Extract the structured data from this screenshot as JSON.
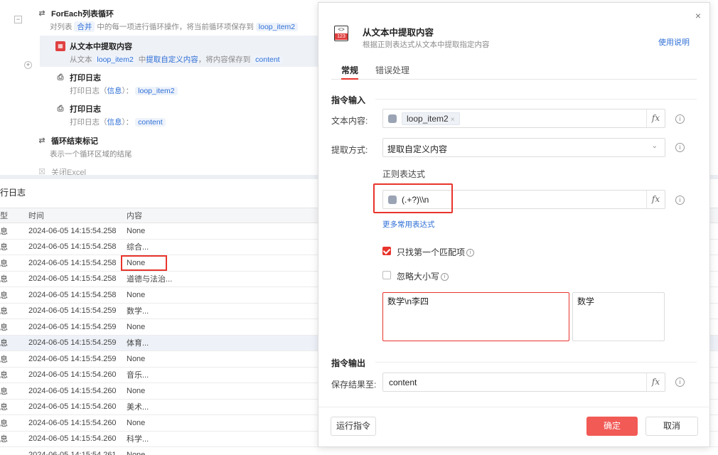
{
  "flow": {
    "items": [
      {
        "title": "ForEach列表循环",
        "desc_pre": "对列表 ",
        "desc_pill": "合并",
        "desc_mid": " 中的每一项进行循环操作，将当前循环项保存到 ",
        "desc_pill2": "loop_item2",
        "icon": "loop-icon"
      },
      {
        "title": "从文本中提取内容",
        "desc_pre": "从文本 ",
        "desc_pill": "loop_item2",
        "desc_mid": " 中",
        "desc_link": "提取自定义内容",
        "desc_post": "，将内容保存到 ",
        "desc_pill2": "content",
        "icon": "extract-text-icon"
      },
      {
        "title": "打印日志",
        "desc_pre": "打印日志（",
        "desc_pill": "信息",
        "desc_mid": "）： ",
        "desc_pill2": "loop_item2",
        "icon": "print-icon"
      },
      {
        "title": "打印日志",
        "desc_pre": "打印日志（",
        "desc_pill": "信息",
        "desc_mid": "）： ",
        "desc_pill2": "content",
        "icon": "print-icon"
      },
      {
        "title": "循环结束标记",
        "desc_pre": "表示一个循环区域的结尾",
        "icon": "loop-end-icon"
      },
      {
        "title": "关闭Excel",
        "icon": "excel-icon"
      }
    ],
    "collapse_symbol": "−",
    "add_symbol": "+"
  },
  "log": {
    "title": "行日志",
    "headers": {
      "type": "型",
      "time": "时间",
      "content": "内容"
    },
    "rows": [
      {
        "type": "息",
        "time": "2024-06-05 14:15:54.258",
        "content": "None"
      },
      {
        "type": "息",
        "time": "2024-06-05 14:15:54.258",
        "content": "综合..."
      },
      {
        "type": "息",
        "time": "2024-06-05 14:15:54.258",
        "content": "None"
      },
      {
        "type": "息",
        "time": "2024-06-05 14:15:54.258",
        "content": "道德与法治..."
      },
      {
        "type": "息",
        "time": "2024-06-05 14:15:54.258",
        "content": "None"
      },
      {
        "type": "息",
        "time": "2024-06-05 14:15:54.259",
        "content": "数学..."
      },
      {
        "type": "息",
        "time": "2024-06-05 14:15:54.259",
        "content": "None"
      },
      {
        "type": "息",
        "time": "2024-06-05 14:15:54.259",
        "content": "体育..."
      },
      {
        "type": "息",
        "time": "2024-06-05 14:15:54.259",
        "content": "None"
      },
      {
        "type": "息",
        "time": "2024-06-05 14:15:54.260",
        "content": "音乐..."
      },
      {
        "type": "息",
        "time": "2024-06-05 14:15:54.260",
        "content": "None"
      },
      {
        "type": "息",
        "time": "2024-06-05 14:15:54.260",
        "content": "美术..."
      },
      {
        "type": "息",
        "time": "2024-06-05 14:15:54.260",
        "content": "None"
      },
      {
        "type": "息",
        "time": "2024-06-05 14:15:54.260",
        "content": "科学..."
      },
      {
        "type": "",
        "time": "2024-06-05 14:15:54.261",
        "content": "None"
      }
    ]
  },
  "dialog": {
    "title": "从文本中提取内容",
    "subtitle": "根据正则表达式从文本中提取指定内容",
    "help": "使用说明",
    "icon_top": "<>",
    "icon_bottom": "123",
    "close": "×",
    "tabs": [
      "常规",
      "错误处理"
    ],
    "section_input": "指令输入",
    "text_label": "文本内容:",
    "text_tag": "loop_item2",
    "method_label": "提取方式:",
    "method_value": "提取自定义内容",
    "regex_label": "正则表达式",
    "regex_value": "(.+?)\\\\n",
    "more_regex": "更多常用表达式",
    "first_match_label": "只找第一个匹配项",
    "ignore_case_label": "忽略大小写",
    "first_match_checked": true,
    "ignore_case_checked": false,
    "test_input": "数学\\n李四",
    "test_output": "数学",
    "section_output": "指令输出",
    "save_label": "保存结果至:",
    "save_value": "content",
    "fx": "fx",
    "info": "i",
    "run_button": "运行指令",
    "ok_button": "确定",
    "cancel_button": "取消"
  },
  "colors": {
    "accent": "#e8342c",
    "ok_button": "#f15a55",
    "link": "#2f6fd6"
  }
}
